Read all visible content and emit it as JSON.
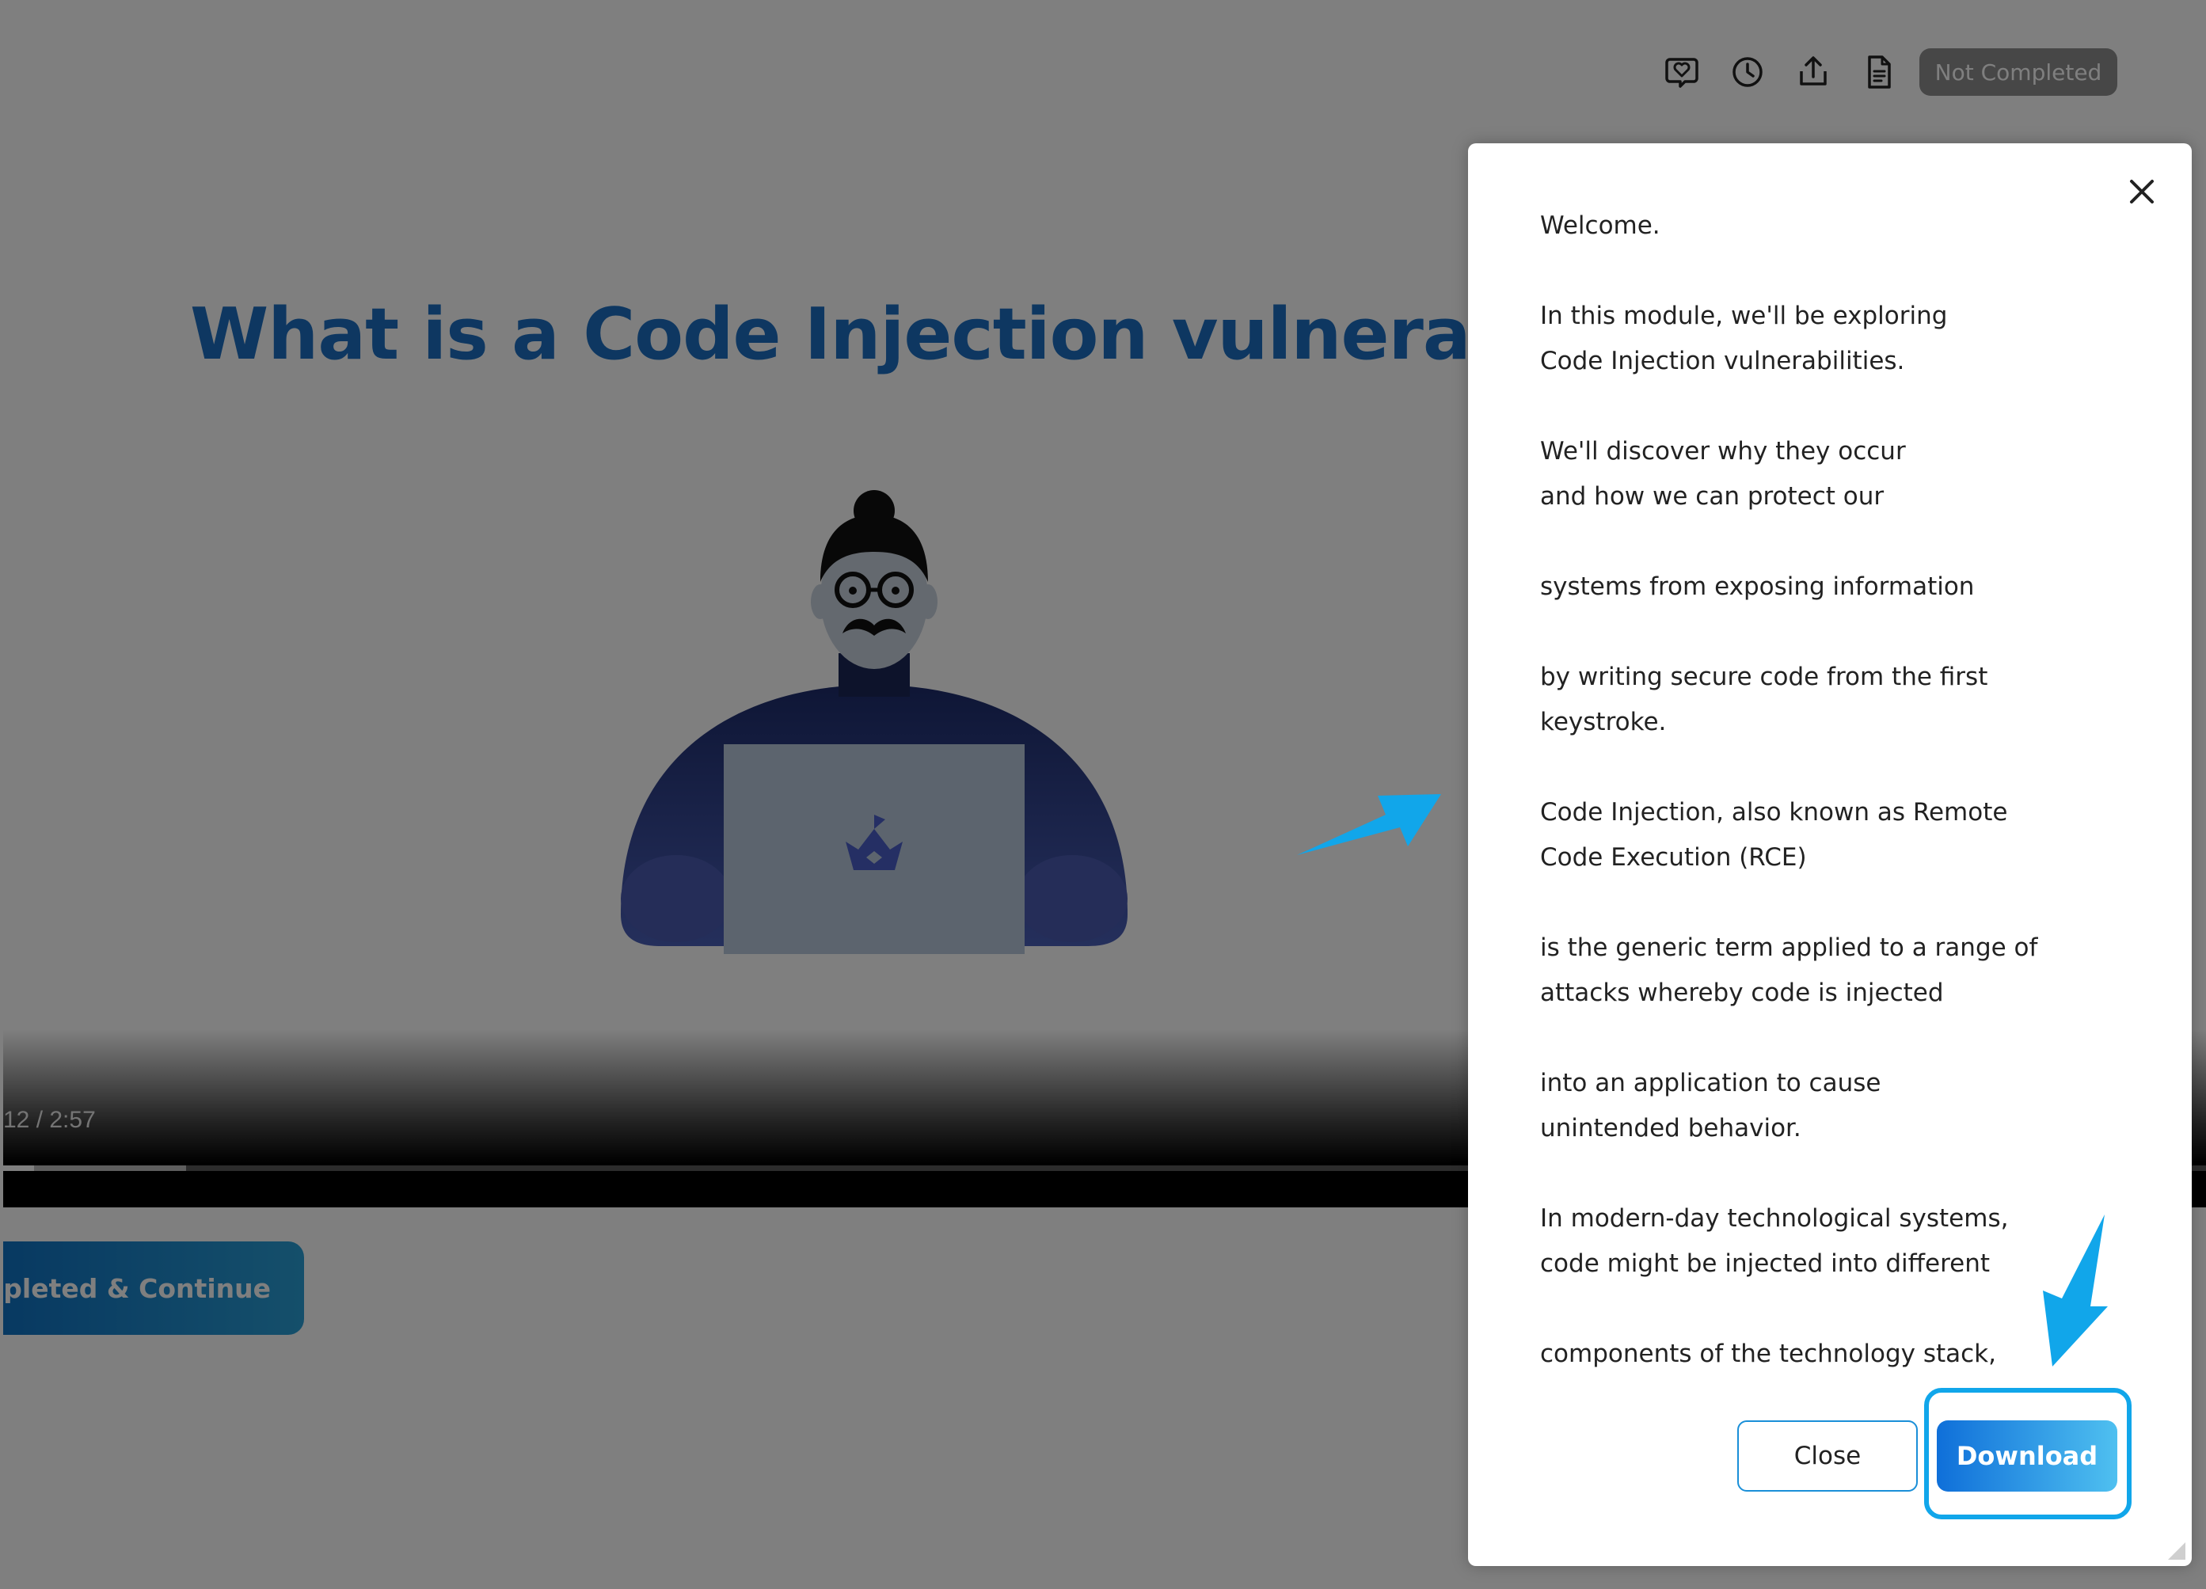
{
  "toolbar": {
    "icons": [
      "comment-heart-icon",
      "clock-icon",
      "share-icon",
      "transcript-document-icon"
    ],
    "status_badge": "Not Completed"
  },
  "slide": {
    "title": "What is a Code Injection vulnerabilit"
  },
  "video": {
    "time_display": "12 / 2:57",
    "played_fraction": 0.014,
    "buffered_fraction": 0.083
  },
  "continue_button": {
    "label": "ompleted & Continue"
  },
  "transcript_dialog": {
    "paragraphs": [
      [
        "Welcome."
      ],
      [
        "In this module, we'll be exploring",
        "Code Injection vulnerabilities."
      ],
      [
        "We'll discover why they occur",
        "and how we can protect our"
      ],
      [
        "systems from exposing information"
      ],
      [
        "by writing secure code from the first",
        "keystroke."
      ],
      [
        "Code Injection, also known as Remote",
        "Code Execution (RCE)"
      ],
      [
        "is the generic term applied to a range of",
        "attacks whereby code is injected"
      ],
      [
        "into an application to cause",
        "unintended behavior."
      ],
      [
        "In modern-day technological systems,",
        "code might be injected into different"
      ],
      [
        "components of the technology stack,"
      ]
    ],
    "close_label": "Close",
    "download_label": "Download"
  },
  "colors": {
    "title_blue": "#1c6fc2",
    "annotation_blue": "#11a6ea",
    "download_gradient_start": "#0f6fd9",
    "download_gradient_end": "#4fc0f0"
  }
}
